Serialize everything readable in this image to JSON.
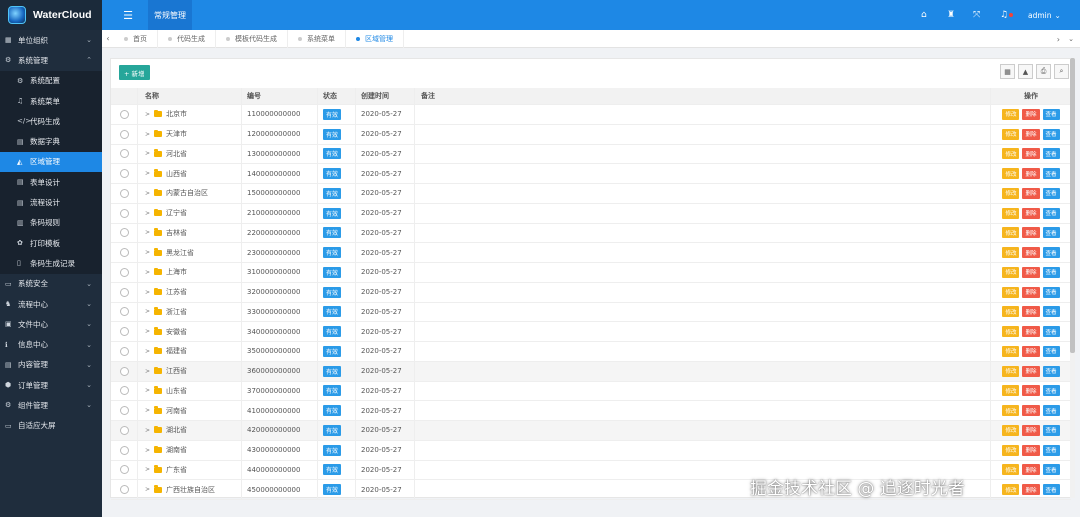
{
  "app": {
    "logo_text": "WaterCloud",
    "top_tab": "常规管理",
    "user": "admin"
  },
  "sidebar": {
    "items": [
      {
        "label": "单位组织",
        "icon": "grid-icon",
        "glyph": "▦",
        "expandable": true,
        "arrow": "⌄"
      },
      {
        "label": "系统管理",
        "icon": "cogs-icon",
        "glyph": "⚙",
        "expandable": true,
        "arrow": "⌃"
      },
      {
        "label": "系统配置",
        "icon": "cogs-icon",
        "glyph": "⚙",
        "sub": true
      },
      {
        "label": "系统菜单",
        "icon": "music-icon",
        "glyph": "♫",
        "sub": true
      },
      {
        "label": "代码生成",
        "icon": "code-icon",
        "glyph": "</>",
        "sub": true
      },
      {
        "label": "数据字典",
        "icon": "book-icon",
        "glyph": "▤",
        "sub": true
      },
      {
        "label": "区域管理",
        "icon": "area-chart-icon",
        "glyph": "◭",
        "sub": true,
        "active": true
      },
      {
        "label": "表单设计",
        "icon": "list-alt-icon",
        "glyph": "▤",
        "sub": true
      },
      {
        "label": "流程设计",
        "icon": "list-alt-icon",
        "glyph": "▤",
        "sub": true
      },
      {
        "label": "条码规则",
        "icon": "barcode-icon",
        "glyph": "▥",
        "sub": true
      },
      {
        "label": "打印模板",
        "icon": "print-template-icon",
        "glyph": "✿",
        "sub": true
      },
      {
        "label": "条码生成记录",
        "icon": "file-icon",
        "glyph": "▯",
        "sub": true
      },
      {
        "label": "系统安全",
        "icon": "desktop-icon",
        "glyph": "▭",
        "expandable": true,
        "arrow": "⌄"
      },
      {
        "label": "流程中心",
        "icon": "sitemap-icon",
        "glyph": "♞",
        "expandable": true,
        "arrow": "⌄"
      },
      {
        "label": "文件中心",
        "icon": "folder-icon",
        "glyph": "▣",
        "expandable": true,
        "arrow": "⌄"
      },
      {
        "label": "信息中心",
        "icon": "info-icon",
        "glyph": "ℹ",
        "expandable": true,
        "arrow": "⌄"
      },
      {
        "label": "内容管理",
        "icon": "list-icon",
        "glyph": "▤",
        "expandable": true,
        "arrow": "⌄"
      },
      {
        "label": "订单管理",
        "icon": "cube-icon",
        "glyph": "⬢",
        "expandable": true,
        "arrow": "⌄"
      },
      {
        "label": "组件管理",
        "icon": "gear-icon",
        "glyph": "⚙",
        "expandable": true,
        "arrow": "⌄"
      },
      {
        "label": "自适应大屏",
        "icon": "desktop-icon",
        "glyph": "▭"
      }
    ]
  },
  "tabs": [
    {
      "label": "首页",
      "active": false
    },
    {
      "label": "代码生成",
      "active": false
    },
    {
      "label": "模板代码生成",
      "active": false
    },
    {
      "label": "系统菜单",
      "active": false
    },
    {
      "label": "区域管理",
      "active": true
    }
  ],
  "toolbar": {
    "add_label": "+ 新增",
    "add_icon": "plus-icon"
  },
  "table": {
    "headers": {
      "name": "名称",
      "code": "编号",
      "state": "状态",
      "date": "创建时间",
      "remark": "备注",
      "ops": "操作"
    },
    "action_labels": {
      "edit": "修改",
      "delete": "删除",
      "view": "查看"
    },
    "rows": [
      {
        "name": "北京市",
        "code": "110000000000",
        "state": "有效",
        "date": "2020-05-27"
      },
      {
        "name": "天津市",
        "code": "120000000000",
        "state": "有效",
        "date": "2020-05-27"
      },
      {
        "name": "河北省",
        "code": "130000000000",
        "state": "有效",
        "date": "2020-05-27"
      },
      {
        "name": "山西省",
        "code": "140000000000",
        "state": "有效",
        "date": "2020-05-27"
      },
      {
        "name": "内蒙古自治区",
        "code": "150000000000",
        "state": "有效",
        "date": "2020-05-27"
      },
      {
        "name": "辽宁省",
        "code": "210000000000",
        "state": "有效",
        "date": "2020-05-27"
      },
      {
        "name": "吉林省",
        "code": "220000000000",
        "state": "有效",
        "date": "2020-05-27"
      },
      {
        "name": "黑龙江省",
        "code": "230000000000",
        "state": "有效",
        "date": "2020-05-27"
      },
      {
        "name": "上海市",
        "code": "310000000000",
        "state": "有效",
        "date": "2020-05-27"
      },
      {
        "name": "江苏省",
        "code": "320000000000",
        "state": "有效",
        "date": "2020-05-27"
      },
      {
        "name": "浙江省",
        "code": "330000000000",
        "state": "有效",
        "date": "2020-05-27"
      },
      {
        "name": "安徽省",
        "code": "340000000000",
        "state": "有效",
        "date": "2020-05-27"
      },
      {
        "name": "福建省",
        "code": "350000000000",
        "state": "有效",
        "date": "2020-05-27"
      },
      {
        "name": "江西省",
        "code": "360000000000",
        "state": "有效",
        "date": "2020-05-27"
      },
      {
        "name": "山东省",
        "code": "370000000000",
        "state": "有效",
        "date": "2020-05-27"
      },
      {
        "name": "河南省",
        "code": "410000000000",
        "state": "有效",
        "date": "2020-05-27"
      },
      {
        "name": "湖北省",
        "code": "420000000000",
        "state": "有效",
        "date": "2020-05-27"
      },
      {
        "name": "湖南省",
        "code": "430000000000",
        "state": "有效",
        "date": "2020-05-27"
      },
      {
        "name": "广东省",
        "code": "440000000000",
        "state": "有效",
        "date": "2020-05-27"
      },
      {
        "name": "广西壮族自治区",
        "code": "450000000000",
        "state": "有效",
        "date": "2020-05-27"
      }
    ]
  },
  "watermark": "掘金技术社区 @ 追逐时光者",
  "colors": {
    "primary": "#1e88e5",
    "sidebar_bg": "#1f2d3d",
    "edit": "#f6b51e",
    "delete": "#f05a48",
    "view": "#2b9be8",
    "add": "#26a69a"
  }
}
